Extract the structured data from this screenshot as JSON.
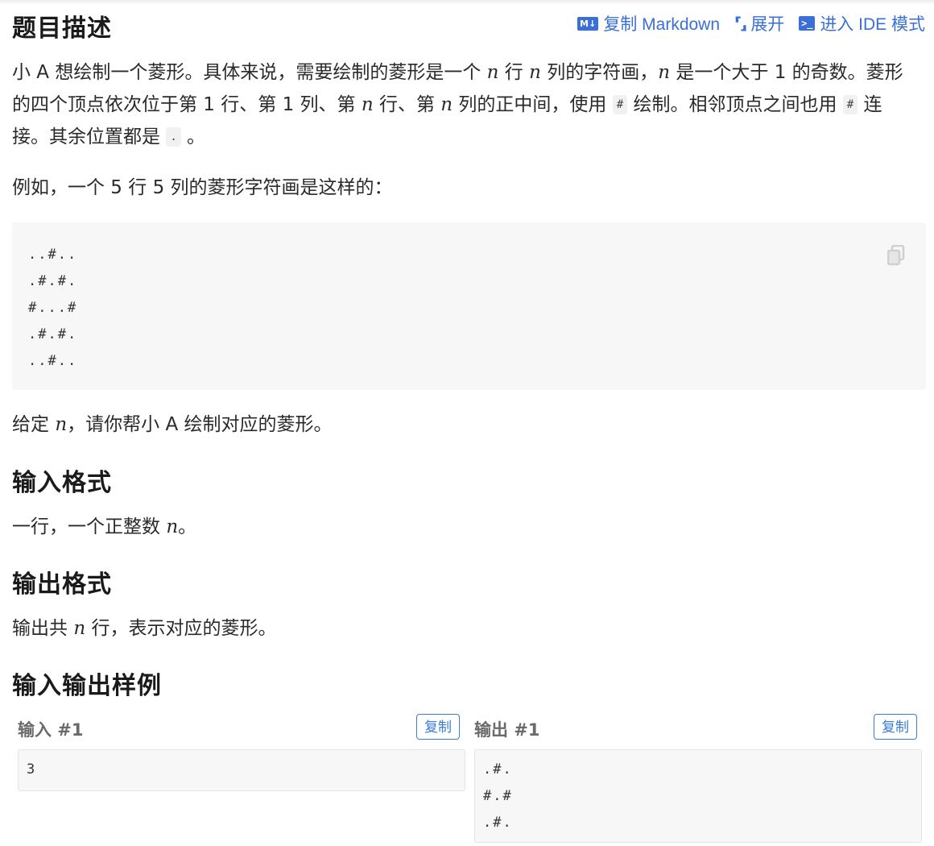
{
  "header": {
    "title": "题目描述",
    "actions": {
      "copy_markdown": "复制 Markdown",
      "expand": "展开",
      "enter_ide": "进入 IDE 模式"
    }
  },
  "description": {
    "p1_a": "小 A 想绘制一个菱形。具体来说，需要绘制的菱形是一个 ",
    "p1_var1": "n",
    "p1_b": " 行 ",
    "p1_var2": "n",
    "p1_c": " 列的字符画，",
    "p1_var3": "n",
    "p1_d": " 是一个大于 1 的奇数。菱形的四个顶点依次位于第 1 行、第 1 列、第 ",
    "p1_var4": "n",
    "p1_e": " 行、第 ",
    "p1_var5": "n",
    "p1_f": " 列的正中间，使用 ",
    "p1_code1": "#",
    "p1_g": " 绘制。相邻顶点之间也用 ",
    "p1_code2": "#",
    "p1_h": " 连接。其余位置都是 ",
    "p1_code3": ".",
    "p1_i": " 。",
    "p2": "例如，一个 5 行 5 列的菱形字符画是这样的：",
    "example_code": "..#..\n.#.#.\n#...#\n.#.#.\n..#..",
    "p3_a": "给定 ",
    "p3_var": "n",
    "p3_b": "，请你帮小 A 绘制对应的菱形。"
  },
  "input_format": {
    "title": "输入格式",
    "text_a": "一行，一个正整数 ",
    "text_var": "n",
    "text_b": "。"
  },
  "output_format": {
    "title": "输出格式",
    "text_a": "输出共 ",
    "text_var": "n",
    "text_b": " 行，表示对应的菱形。"
  },
  "samples": {
    "title": "输入输出样例",
    "input_label": "输入 #1",
    "output_label": "输出 #1",
    "copy_label": "复制",
    "input_value": "3",
    "output_value": ".#.\n#.#\n.#."
  },
  "icons": {
    "markdown": "markdown-icon",
    "expand": "expand-icon",
    "ide": "terminal-icon",
    "copy": "copy-icon"
  },
  "colors": {
    "accent": "#3a6fd8"
  }
}
